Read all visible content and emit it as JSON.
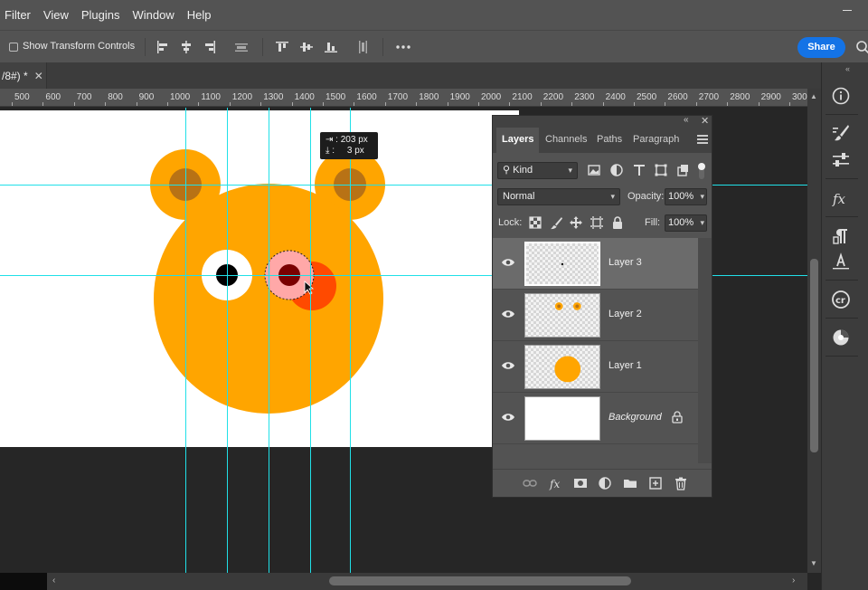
{
  "menubar": {
    "items": [
      "Filter",
      "View",
      "Plugins",
      "Window",
      "Help"
    ]
  },
  "options_bar": {
    "show_transform_controls_label": "Show Transform Controls",
    "show_transform_controls_checked": false,
    "share_label": "Share"
  },
  "document": {
    "tab_label": "/8#) *",
    "tab_close": "✕"
  },
  "ruler": {
    "ticks": [
      "500",
      "600",
      "700",
      "800",
      "900",
      "1000",
      "1100",
      "1200",
      "1300",
      "1400",
      "1500",
      "1600",
      "1700",
      "1800",
      "1900",
      "2000",
      "2100",
      "2200",
      "2300",
      "2400",
      "2500",
      "2600",
      "2700",
      "2800",
      "2900",
      "300"
    ]
  },
  "measure_tooltip": {
    "horizontal": "203 px",
    "vertical": "3 px"
  },
  "layers_panel": {
    "tabs": [
      "Layers",
      "Channels",
      "Paths",
      "Paragraph"
    ],
    "active_tab": "Layers",
    "filter_kind": "Kind",
    "blend_mode": "Normal",
    "opacity_label": "Opacity:",
    "opacity_value": "100%",
    "lock_label": "Lock:",
    "fill_label": "Fill:",
    "fill_value": "100%",
    "layers": [
      {
        "name": "Layer 3",
        "selected": true,
        "visible": true
      },
      {
        "name": "Layer 2",
        "selected": false,
        "visible": true
      },
      {
        "name": "Layer 1",
        "selected": false,
        "visible": true
      },
      {
        "name": "Background",
        "selected": false,
        "visible": true,
        "locked": true
      }
    ]
  },
  "colors": {
    "guide": "#20e0e8",
    "bear_orange": "#ffa500",
    "ear_inner": "#b87215",
    "accent_blue": "#1473e6",
    "selected_layer": "#6b6b6b"
  },
  "icons": {
    "right_toolbar": [
      "info-icon",
      "brush-settings-icon",
      "adjustments-icon",
      "fx-icon",
      "character-paragraph-icon",
      "type-icon",
      "cc-libraries-icon",
      "color-icon"
    ],
    "panel_footer": [
      "link-layers-icon",
      "fx-icon",
      "layer-mask-icon",
      "adjustment-layer-icon",
      "group-folder-icon",
      "new-layer-icon",
      "trash-icon"
    ]
  }
}
